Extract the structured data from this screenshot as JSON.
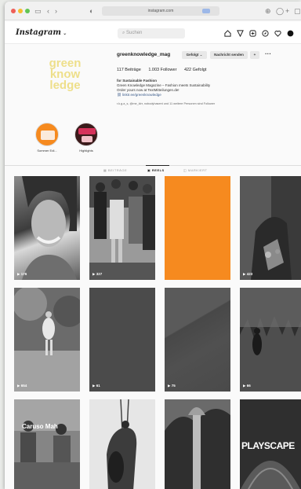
{
  "browser": {
    "url": "instagram.com",
    "icons": [
      "sidebar-icon",
      "back-icon",
      "forward-icon",
      "shield-icon",
      "refresh-icon",
      "download-icon",
      "add-tab-icon"
    ]
  },
  "nav": {
    "logo": "Instagram",
    "search_placeholder": "Suchen",
    "icons": [
      "home-icon",
      "send-icon",
      "add-post-icon",
      "explore-icon",
      "heart-icon",
      "profile-icon"
    ]
  },
  "profile": {
    "avatar_text": [
      "green",
      "know",
      "ledge"
    ],
    "avatar_bg": "#f7f7f7",
    "username": "greenknowledge_mag",
    "following_button": "Gefolgt",
    "message_button": "Nachricht senden",
    "stats": {
      "posts": "117 Beiträge",
      "followers": "1.003 Follower",
      "following": "422 Gefolgt"
    },
    "bio": {
      "name": "for Sustainable Fashion",
      "line1": "Green Knowledge Magazine – Fashion meets Sustainability",
      "line2": "Order yours now at TextMitteilungen.de!",
      "link": "linktr.ee/greenknowledge"
    },
    "followed_by": "r.k.g.a_s, @me_klrr, nobodyhasent und 11 weitere Personen sind Follower"
  },
  "highlights": [
    {
      "label": "Sommer Edi..."
    },
    {
      "label": "Highlights"
    }
  ],
  "tabs": [
    {
      "label": "BEITRÄGE",
      "active": false
    },
    {
      "label": "REELS",
      "active": true
    },
    {
      "label": "MARKIERT",
      "active": false
    }
  ],
  "colors": {
    "accent_orange": "#f68a1f",
    "avatar_yellow": "#eedf8a"
  },
  "reels": [
    {
      "views": "176",
      "overlay": ""
    },
    {
      "views": "327",
      "overlay": ""
    },
    {
      "views": "",
      "overlay": ""
    },
    {
      "views": "423",
      "overlay": ""
    },
    {
      "views": "654",
      "overlay": ""
    },
    {
      "views": "61",
      "overlay": ""
    },
    {
      "views": "75",
      "overlay": ""
    },
    {
      "views": "66",
      "overlay": ""
    },
    {
      "views": "",
      "overlay": "Caruso Mah"
    },
    {
      "views": "",
      "overlay": ""
    },
    {
      "views": "",
      "overlay": ""
    },
    {
      "views": "",
      "overlay": "PLAYSCAPE"
    }
  ]
}
